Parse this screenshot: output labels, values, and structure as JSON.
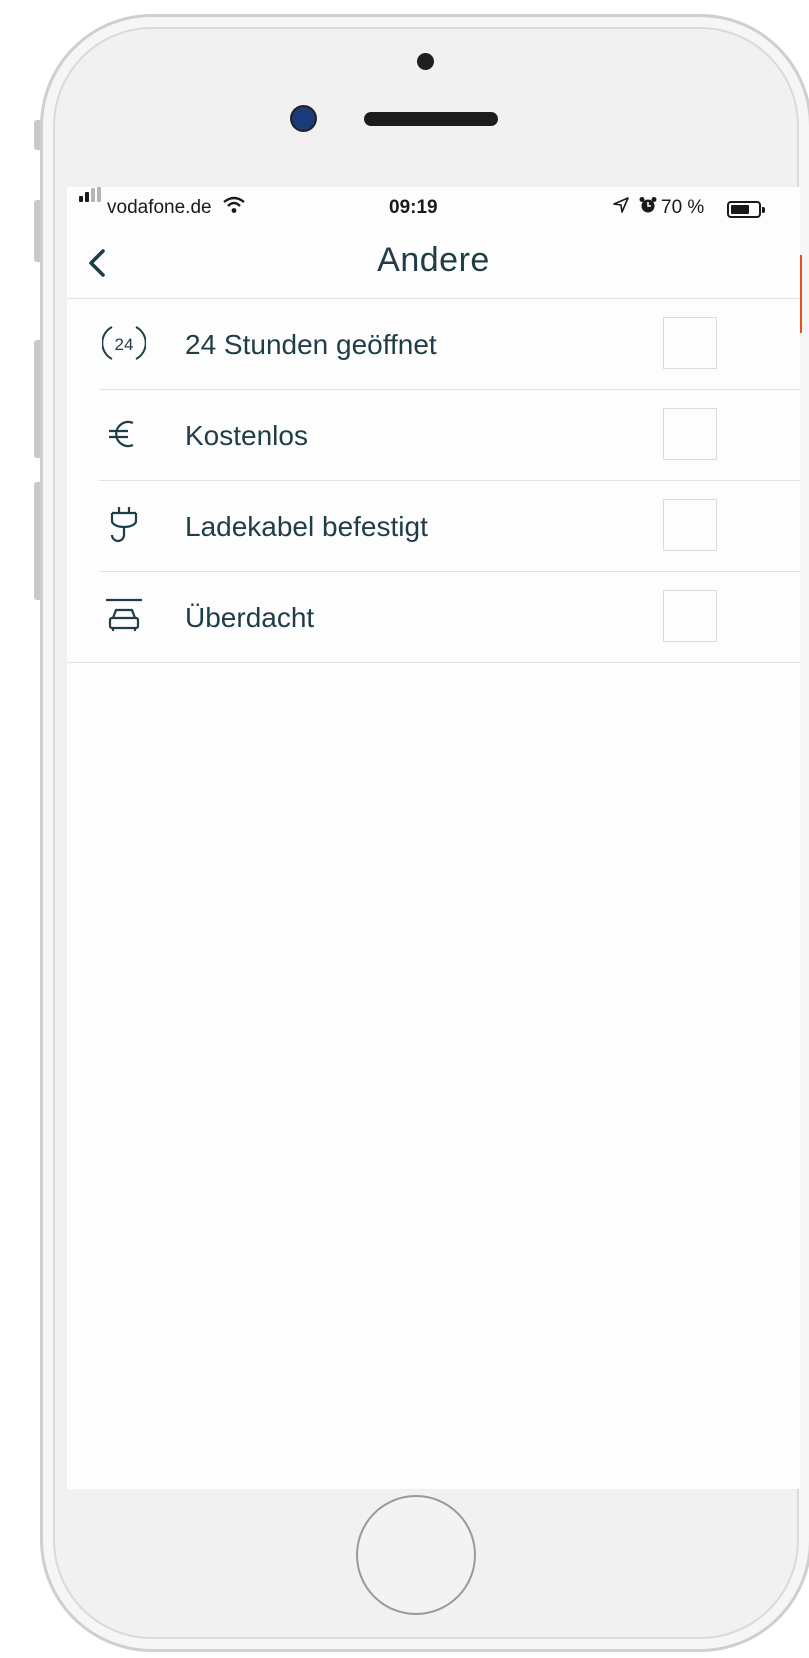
{
  "status_bar": {
    "carrier": "vodafone.de",
    "time": "09:19",
    "battery_percent": "70 %",
    "battery_level": 0.7
  },
  "navbar": {
    "title": "Andere"
  },
  "filters": [
    {
      "label": "24 Stunden geöffnet",
      "icon": "24-hours-icon",
      "checked": false
    },
    {
      "label": "Kostenlos",
      "icon": "euro-icon",
      "checked": false
    },
    {
      "label": "Ladekabel befestigt",
      "icon": "plug-icon",
      "checked": false
    },
    {
      "label": "Überdacht",
      "icon": "covered-car-icon",
      "checked": false
    }
  ],
  "colors": {
    "text": "#1f3d47",
    "divider": "#e2e2e2",
    "accent": "#e8501f"
  }
}
